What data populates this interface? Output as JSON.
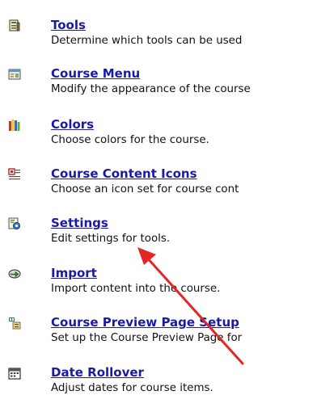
{
  "colors": {
    "link": "#1a1aa6",
    "description": "#111111",
    "annotation_arrow": "#e32626"
  },
  "menu": {
    "items": [
      {
        "icon": "tools-icon",
        "title": "Tools",
        "description": "Determine which tools can be used"
      },
      {
        "icon": "course-menu-icon",
        "title": "Course Menu",
        "description": "Modify the appearance of the course"
      },
      {
        "icon": "colors-icon",
        "title": "Colors",
        "description": "Choose colors for the course."
      },
      {
        "icon": "course-content-icons-icon",
        "title": "Course Content Icons",
        "description": "Choose an icon set for course cont"
      },
      {
        "icon": "settings-icon",
        "title": "Settings",
        "description": "Edit settings for tools."
      },
      {
        "icon": "import-icon",
        "title": "Import",
        "description": "Import content into the course."
      },
      {
        "icon": "preview-page-icon",
        "title": "Course Preview Page Setup",
        "description": "Set up the Course Preview Page for"
      },
      {
        "icon": "date-rollover-icon",
        "title": "Date Rollover",
        "description": "Adjust dates for course items."
      }
    ]
  }
}
